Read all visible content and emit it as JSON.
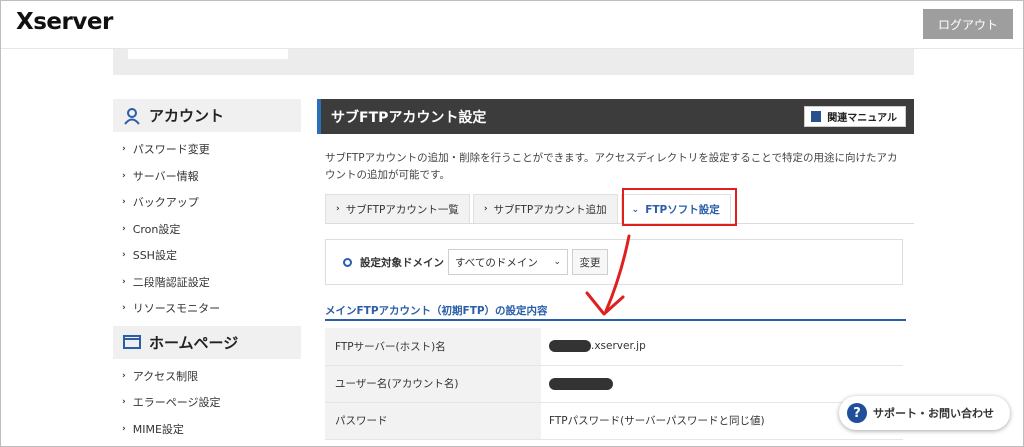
{
  "header": {
    "logo": "Xserver",
    "logout_label": "ログアウト"
  },
  "sidebar": {
    "sections": [
      {
        "title": "アカウント",
        "icon": "person-icon",
        "items": [
          "パスワード変更",
          "サーバー情報",
          "バックアップ",
          "Cron設定",
          "SSH設定",
          "二段階認証設定",
          "リソースモニター"
        ]
      },
      {
        "title": "ホームページ",
        "icon": "window-icon",
        "items": [
          "アクセス制限",
          "エラーページ設定",
          "MIME設定"
        ]
      }
    ]
  },
  "main": {
    "title": "サブFTPアカウント設定",
    "manual_label": "関連マニュアル",
    "description": "サブFTPアカウントの追加・削除を行うことができます。アクセスディレクトリを設定することで特定の用途に向けたアカウントの追加が可能です。",
    "tabs": [
      {
        "label": "サブFTPアカウント一覧",
        "active": false
      },
      {
        "label": "サブFTPアカウント追加",
        "active": false
      },
      {
        "label": "FTPソフト設定",
        "active": true
      }
    ],
    "domain": {
      "label": "設定対象ドメイン",
      "selected": "すべてのドメイン",
      "change_label": "変更"
    },
    "section_title": "メインFTPアカウント（初期FTP）の設定内容",
    "rows": [
      {
        "key": "FTPサーバー(ホスト)名",
        "value": ".xserver.jp"
      },
      {
        "key": "ユーザー名(アカウント名)",
        "value": ""
      },
      {
        "key": "パスワード",
        "value": "FTPパスワード(サーバーパスワードと同じ値)"
      }
    ]
  },
  "support_label": "サポート・お問い合わせ",
  "colors": {
    "accent": "#2a5ea8",
    "annotation": "#e02020",
    "title_bar": "#3c3c3c"
  }
}
